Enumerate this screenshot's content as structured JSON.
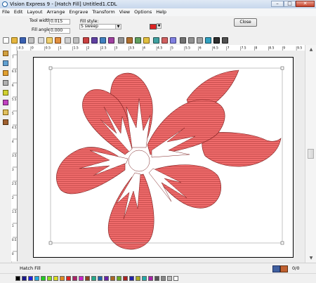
{
  "window": {
    "title": "Vision Express 9 - [Hatch Fill] Untitled1.CDL",
    "minimize": "–",
    "maximize": "□",
    "close": "✕"
  },
  "menu": [
    "File",
    "Edit",
    "Layout",
    "Arrange",
    "Engrave",
    "Transform",
    "View",
    "Options",
    "Help"
  ],
  "options": {
    "tool_width_label": "Tool width:",
    "tool_width_value": "0.015",
    "fill_angle_label": "Fill angle:",
    "fill_angle_value": "0.000",
    "fill_style_label": "Fill style:",
    "fill_style_value": "S sweep",
    "fill_color": "#dd2222",
    "close_label": "Close"
  },
  "rulers": {
    "top_labels": [
      "-0.5",
      "0",
      "0.5",
      "1",
      "1.5",
      "2",
      "2.5",
      "3",
      "3.5",
      "4",
      "4.5",
      "5",
      "5.5",
      "6",
      "6.5",
      "7",
      "7.5",
      "8",
      "8.5",
      "9",
      "9.5"
    ],
    "left_labels": [
      "7",
      "6.5",
      "6",
      "5.5",
      "5",
      "4.5",
      "4",
      "3.5",
      "3",
      "2.5",
      "2",
      "1.5",
      "1",
      "0.5",
      "0"
    ]
  },
  "status": {
    "mode": "Hatch Fill",
    "count": "0/0"
  },
  "artwork": {
    "fill_color": "#ef6b6b",
    "hatch_color": "#b23b3b"
  },
  "palette_colors": [
    "#000000",
    "#1a1a8c",
    "#2222dd",
    "#22aadd",
    "#22cc22",
    "#88dd22",
    "#dddd22",
    "#dd8822",
    "#dd2222",
    "#aa2266",
    "#cc22cc",
    "#884422",
    "#22aa88",
    "#2266aa",
    "#6622aa",
    "#aa6622",
    "#66aa22",
    "#aa2222",
    "#2222aa",
    "#aaaa22",
    "#22aaaa",
    "#aa22aa",
    "#555555",
    "#888888",
    "#bbbbbb",
    "#ffffff"
  ]
}
